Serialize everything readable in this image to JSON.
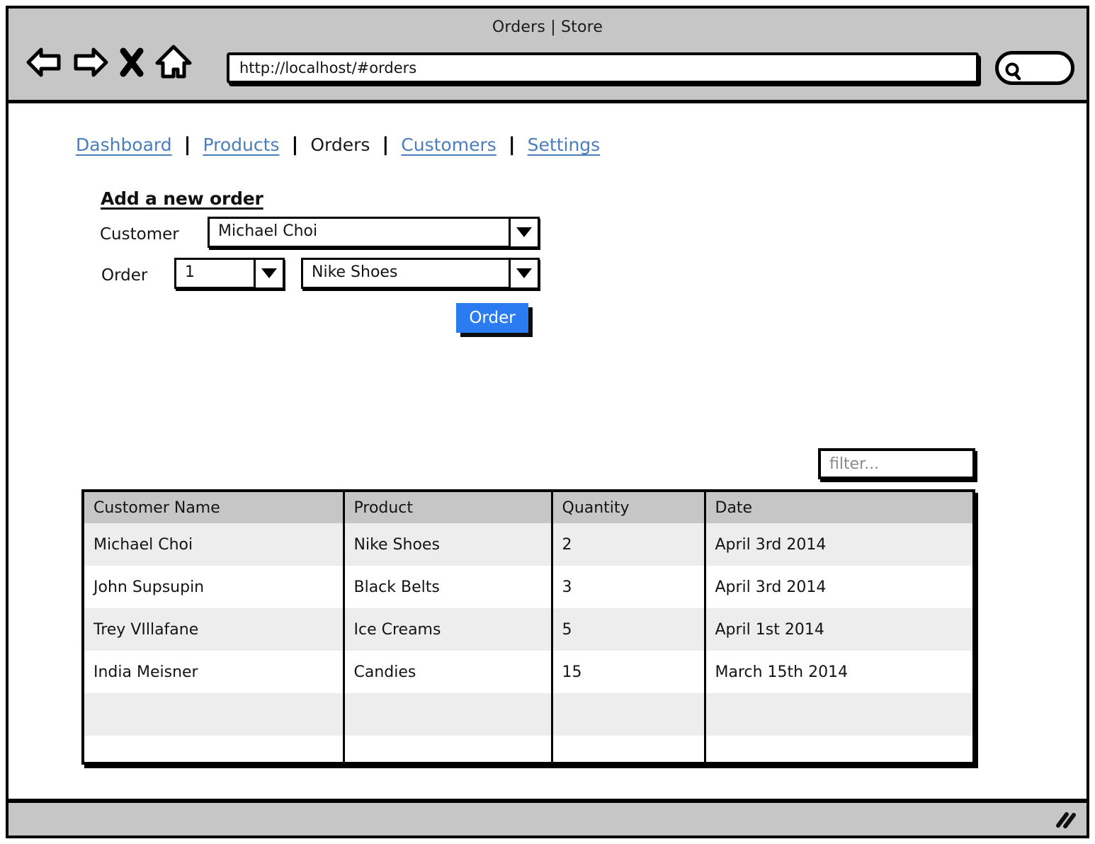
{
  "browser": {
    "window_title": "Orders | Store",
    "url": "http://localhost/#orders",
    "back_icon": "back-arrow-icon",
    "forward_icon": "forward-arrow-icon",
    "stop_icon": "close-x-icon",
    "home_icon": "home-icon",
    "search_icon": "search-icon",
    "search_value": ""
  },
  "nav": {
    "items": [
      {
        "label": "Dashboard",
        "active": false
      },
      {
        "label": "Products",
        "active": false
      },
      {
        "label": "Orders",
        "active": true
      },
      {
        "label": "Customers",
        "active": false
      },
      {
        "label": "Settings",
        "active": false
      }
    ],
    "separator": "|"
  },
  "form": {
    "title": "Add a new order",
    "customer_label": "Customer",
    "customer_value": "Michael Choi",
    "order_label": "Order",
    "quantity_value": "1",
    "product_value": "Nike Shoes",
    "submit_label": "Order",
    "submit_color": "#2b7cf0"
  },
  "filter": {
    "placeholder": "filter...",
    "value": ""
  },
  "table": {
    "columns": [
      "Customer Name",
      "Product",
      "Quantity",
      "Date"
    ],
    "rows": [
      {
        "customer": "Michael Choi",
        "product": "Nike Shoes",
        "quantity": "2",
        "date": "April 3rd 2014"
      },
      {
        "customer": "John Supsupin",
        "product": "Black Belts",
        "quantity": "3",
        "date": "April 3rd 2014"
      },
      {
        "customer": "Trey VIllafane",
        "product": "Ice Creams",
        "quantity": "5",
        "date": "April 1st 2014"
      },
      {
        "customer": "India Meisner",
        "product": "Candies",
        "quantity": "15",
        "date": "March 15th 2014"
      },
      {
        "customer": "",
        "product": "",
        "quantity": "",
        "date": ""
      },
      {
        "customer": "",
        "product": "",
        "quantity": "",
        "date": ""
      }
    ],
    "header_bg": "#c6c6c6",
    "row_alt_bg": "#ededed"
  },
  "statusbar": {
    "resize_icon": "resize-grip-icon"
  }
}
